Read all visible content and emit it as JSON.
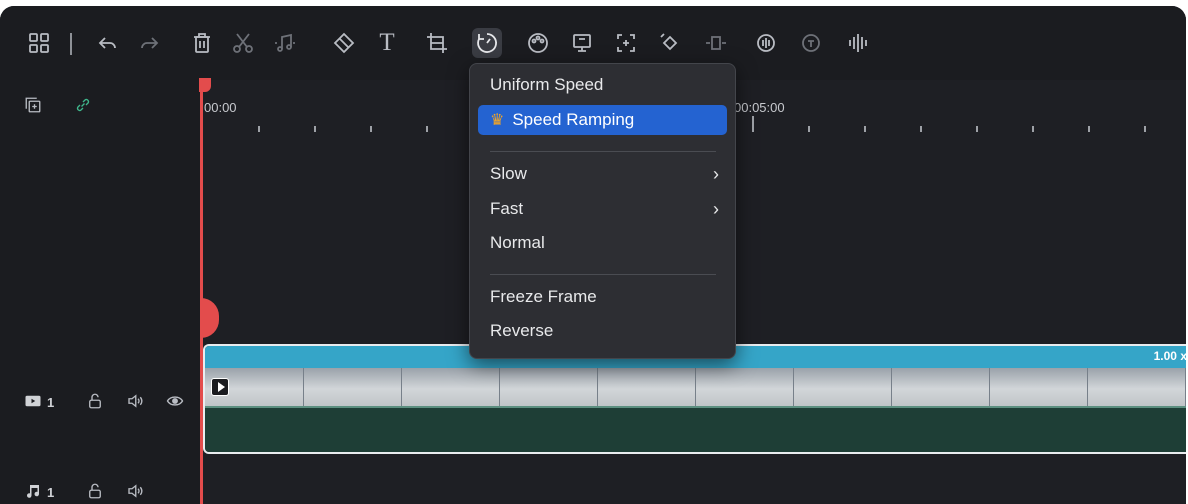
{
  "toolbar": {
    "icons": [
      "layout-icon",
      "undo-icon",
      "redo-icon",
      "delete-icon",
      "cut-icon",
      "audio-split-icon",
      "tag-icon",
      "text-icon",
      "crop-icon",
      "speed-icon",
      "color-icon",
      "freeze-icon",
      "zoom-icon",
      "keyframe-icon",
      "transition-icon",
      "ai-icon",
      "tts-icon",
      "audio-waveform-icon"
    ],
    "text_label": "T"
  },
  "side": {
    "add_track_icon": "add-track-icon",
    "link_icon": "link-icon"
  },
  "timeline": {
    "timecodes": [
      "00:00",
      "00:05:00"
    ],
    "clip_speed": "1.00 x",
    "accent": "#35a5c8",
    "playhead_color": "#e34c4c"
  },
  "tracks": {
    "video_label": "1",
    "audio_label": "1"
  },
  "speed_menu": {
    "items": [
      {
        "label": "Uniform Speed",
        "selected": false
      },
      {
        "label": "Speed Ramping",
        "selected": true,
        "icon": "crown-icon"
      },
      {
        "label": "Slow",
        "submenu": true
      },
      {
        "label": "Fast",
        "submenu": true
      },
      {
        "label": "Normal"
      },
      {
        "label": "Freeze Frame"
      },
      {
        "label": "Reverse"
      }
    ],
    "selection_color": "#2463d1"
  }
}
